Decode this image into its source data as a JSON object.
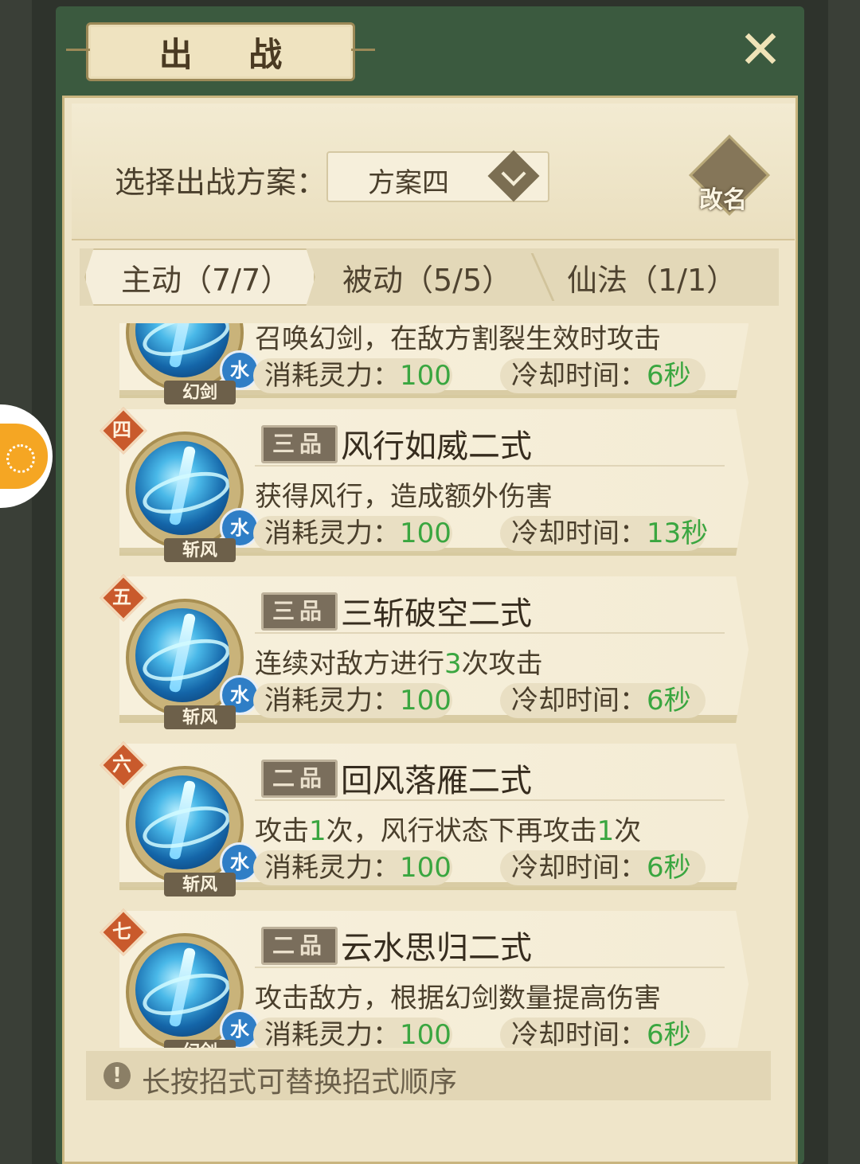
{
  "title": "出 战",
  "close_icon": "close-x-icon",
  "plan": {
    "label": "选择出战方案：",
    "selected": "方案四",
    "rename_label": "改名"
  },
  "tabs": [
    {
      "label": "主动（7/7）",
      "active": true
    },
    {
      "label": "被动（5/5）",
      "active": false
    },
    {
      "label": "仙法（1/1）",
      "active": false
    }
  ],
  "skills": [
    {
      "rank": "",
      "grade": "",
      "name": "",
      "desc_parts": [
        "召唤幻剑，在敌方割裂生效时攻击"
      ],
      "element": "水",
      "type": "幻剑",
      "cost_label": "消耗灵力：",
      "cost": "100",
      "cd_label": "冷却时间：",
      "cd": "6秒"
    },
    {
      "rank": "四",
      "grade": "三品",
      "name": "风行如威二式",
      "desc_parts": [
        "获得风行，造成额外伤害"
      ],
      "element": "水",
      "type": "斩风",
      "cost_label": "消耗灵力：",
      "cost": "100",
      "cd_label": "冷却时间：",
      "cd": "13秒"
    },
    {
      "rank": "五",
      "grade": "三品",
      "name": "三斩破空二式",
      "desc_parts": [
        "连续对敌方进行",
        "3",
        "次攻击"
      ],
      "element": "水",
      "type": "斩风",
      "cost_label": "消耗灵力：",
      "cost": "100",
      "cd_label": "冷却时间：",
      "cd": "6秒"
    },
    {
      "rank": "六",
      "grade": "二品",
      "name": "回风落雁二式",
      "desc_parts": [
        "攻击",
        "1",
        "次，风行状态下再攻击",
        "1",
        "次"
      ],
      "element": "水",
      "type": "斩风",
      "cost_label": "消耗灵力：",
      "cost": "100",
      "cd_label": "冷却时间：",
      "cd": "6秒"
    },
    {
      "rank": "七",
      "grade": "二品",
      "name": "云水思归二式",
      "desc_parts": [
        "攻击敌方，根据幻剑数量提高伤害"
      ],
      "element": "水",
      "type": "幻剑",
      "cost_label": "消耗灵力：",
      "cost": "100",
      "cd_label": "冷却时间：",
      "cd": "6秒"
    }
  ],
  "tip": "长按招式可替换招式顺序",
  "colors": {
    "panel_green": "#3b5a3f",
    "parchment": "#efe5c9",
    "value_green": "#3aa640",
    "rank_red": "#c95a2c",
    "element_blue": "#2f7ec6"
  }
}
